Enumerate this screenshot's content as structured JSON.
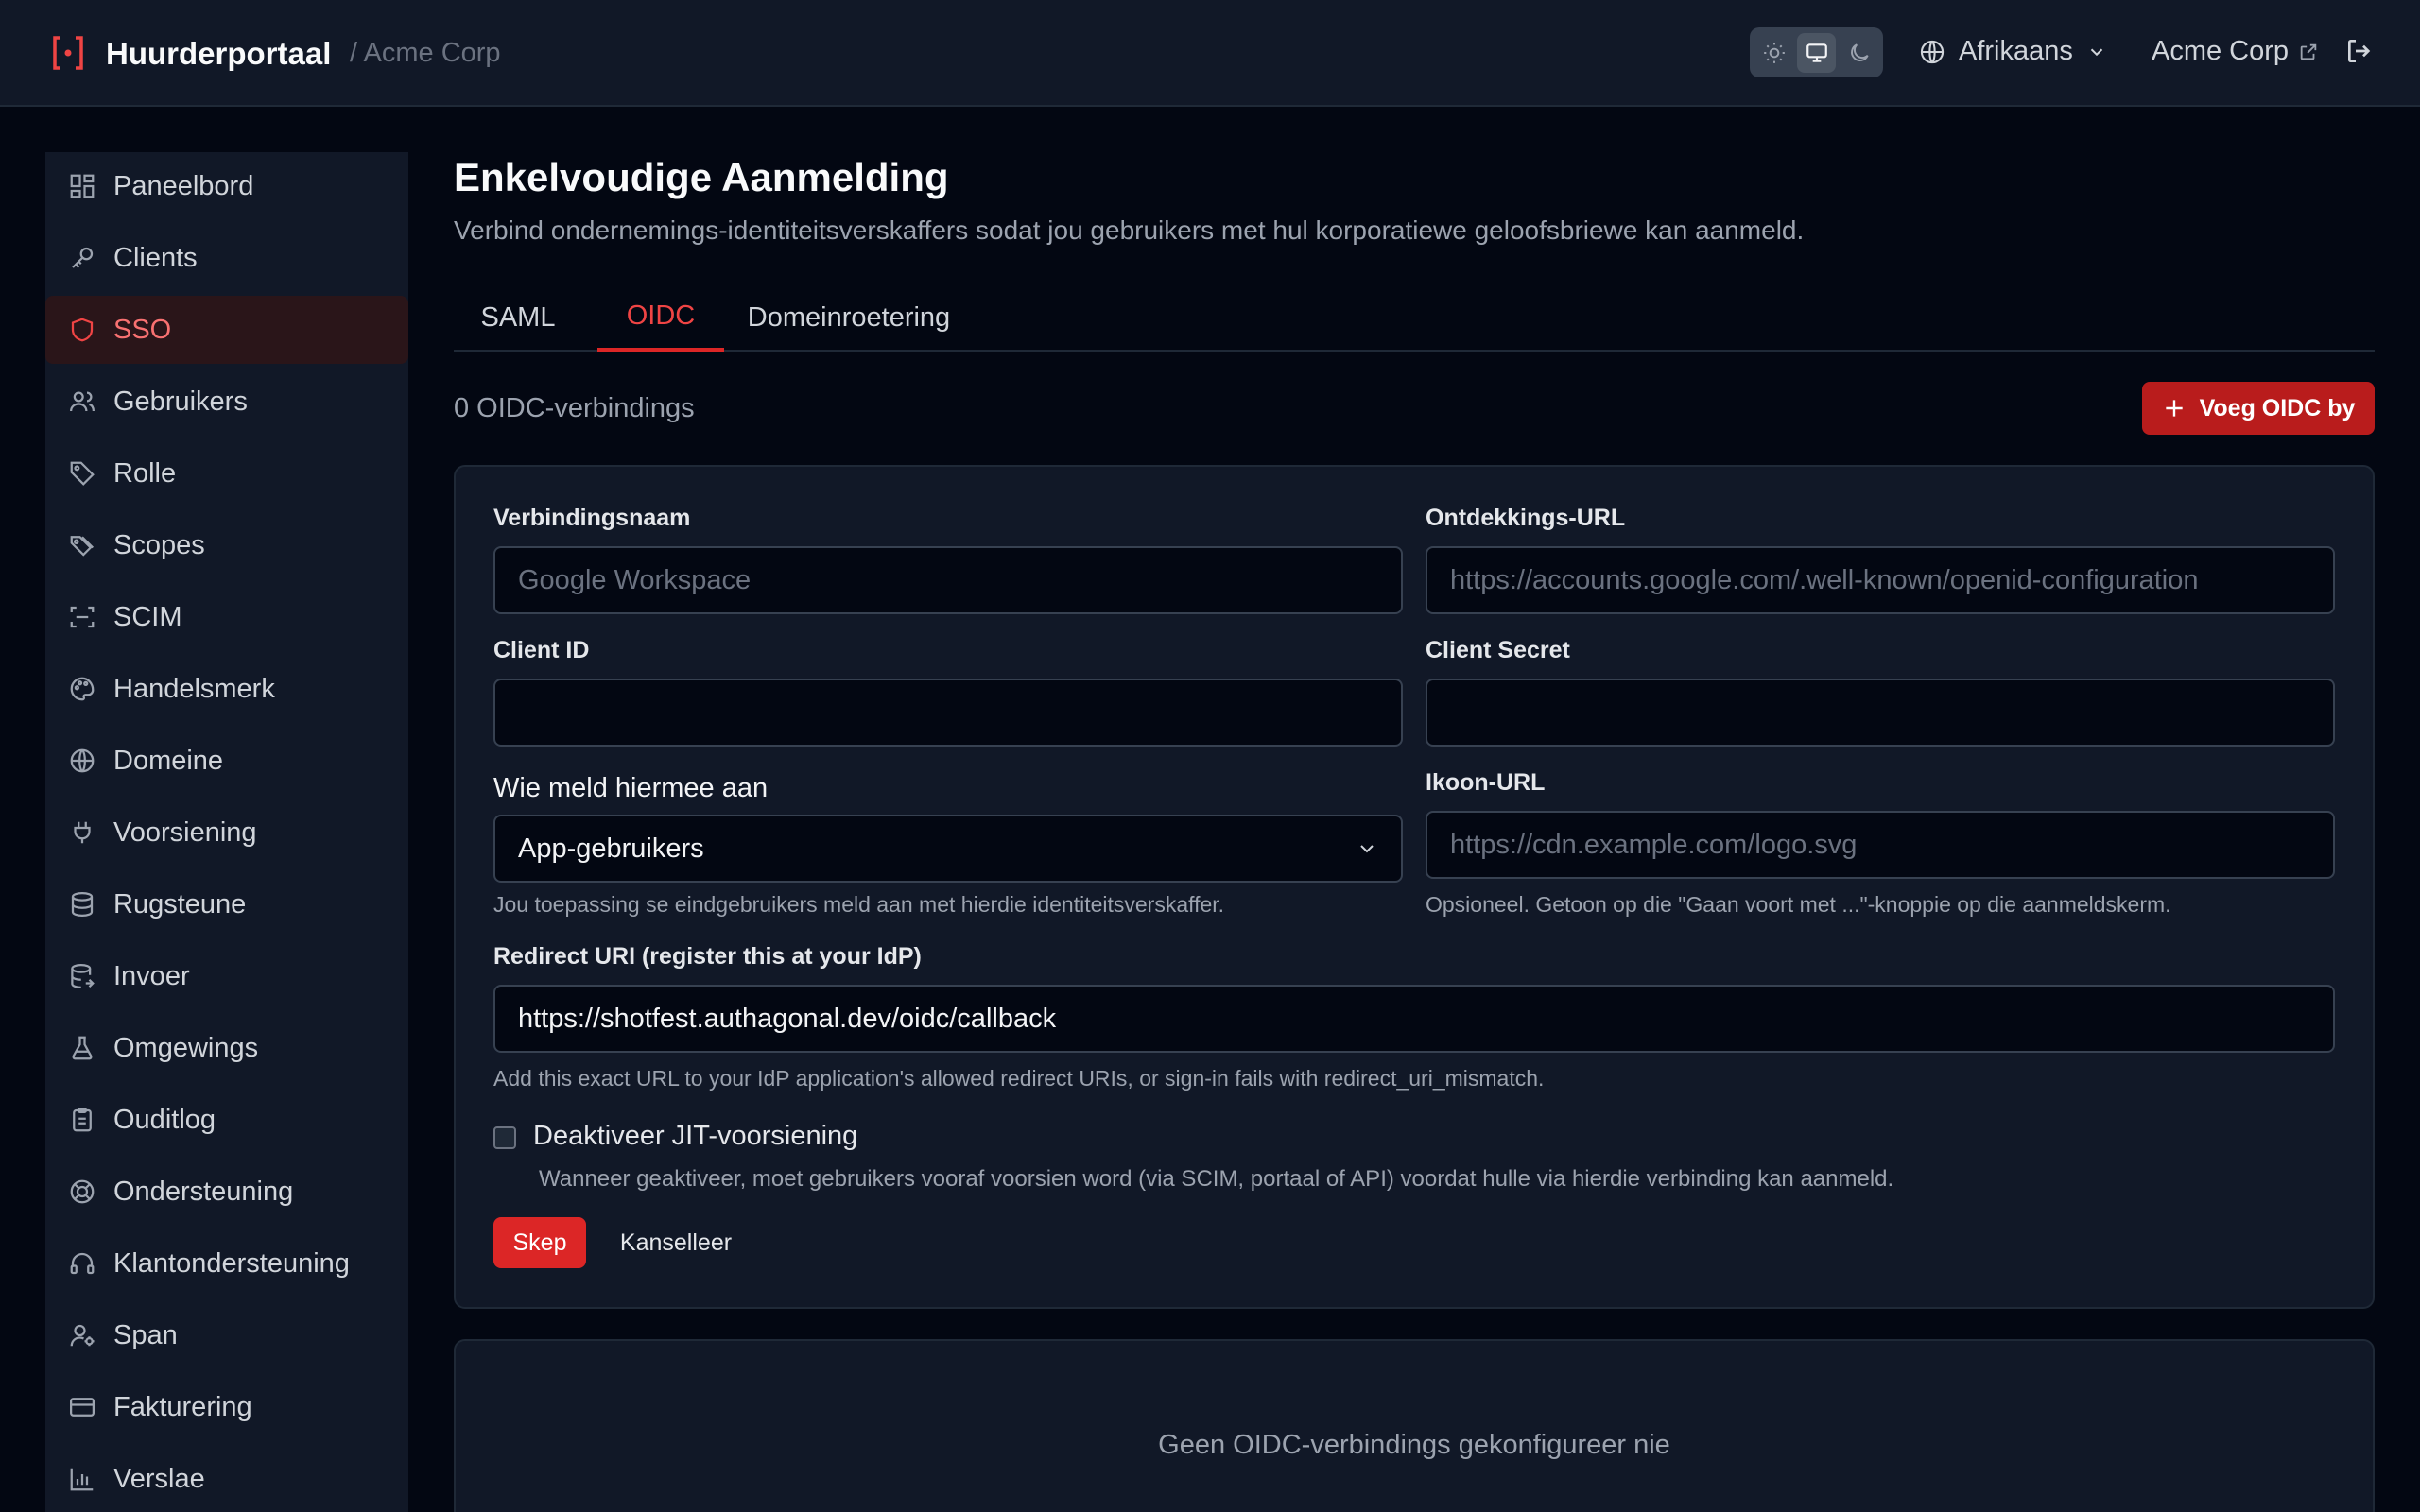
{
  "header": {
    "brand_title": "Huurderportaal",
    "tenant_path": "/ Acme Corp",
    "language": "Afrikaans",
    "tenant_link": "Acme Corp",
    "theme_modes": [
      "light-icon",
      "monitor-icon",
      "moon-icon"
    ],
    "active_theme": "monitor-icon"
  },
  "sidebar": {
    "items": [
      {
        "label": "Paneelbord",
        "icon": "dashboard-icon"
      },
      {
        "label": "Clients",
        "icon": "key-icon"
      },
      {
        "label": "SSO",
        "icon": "shield-icon",
        "active": true
      },
      {
        "label": "Gebruikers",
        "icon": "users-icon"
      },
      {
        "label": "Rolle",
        "icon": "tag-icon"
      },
      {
        "label": "Scopes",
        "icon": "tags-icon"
      },
      {
        "label": "SCIM",
        "icon": "scan-icon"
      },
      {
        "label": "Handelsmerk",
        "icon": "palette-icon"
      },
      {
        "label": "Domeine",
        "icon": "globe-icon"
      },
      {
        "label": "Voorsiening",
        "icon": "plug-icon"
      },
      {
        "label": "Rugsteune",
        "icon": "database-icon"
      },
      {
        "label": "Invoer",
        "icon": "database-import-icon"
      },
      {
        "label": "Omgewings",
        "icon": "flask-icon"
      },
      {
        "label": "Ouditlog",
        "icon": "clipboard-icon"
      },
      {
        "label": "Ondersteuning",
        "icon": "lifebuoy-icon"
      },
      {
        "label": "Klantondersteuning",
        "icon": "headphones-icon"
      },
      {
        "label": "Span",
        "icon": "user-cog-icon"
      },
      {
        "label": "Fakturering",
        "icon": "credit-card-icon"
      },
      {
        "label": "Verslae",
        "icon": "bar-chart-icon"
      }
    ]
  },
  "main": {
    "title": "Enkelvoudige Aanmelding",
    "subtitle": "Verbind ondernemings-identiteitsverskaffers sodat jou gebruikers met hul korporatiewe geloofsbriewe kan aanmeld.",
    "tabs": [
      {
        "label": "SAML"
      },
      {
        "label": "OIDC",
        "active": true
      },
      {
        "label": "Domeinroetering"
      }
    ],
    "connection_count": "0 OIDC-verbindings",
    "add_button": "Voeg OIDC by",
    "form": {
      "name_label": "Verbindingsnaam",
      "name_placeholder": "Google Workspace",
      "discovery_label": "Ontdekkings-URL",
      "discovery_placeholder": "https://accounts.google.com/.well-known/openid-configuration",
      "client_id_label": "Client ID",
      "client_id_value": "",
      "client_secret_label": "Client Secret",
      "client_secret_value": "",
      "audience_label": "Wie meld hiermee aan",
      "audience_value": "App-gebruikers",
      "audience_hint": "Jou toepassing se eindgebruikers meld aan met hierdie identiteitsverskaffer.",
      "icon_label": "Ikoon-URL",
      "icon_placeholder": "https://cdn.example.com/logo.svg",
      "icon_hint": "Opsioneel. Getoon op die \"Gaan voort met ...\"-knoppie op die aanmeldskerm.",
      "redirect_label": "Redirect URI (register this at your IdP)",
      "redirect_value": "https://shotfest.authagonal.dev/oidc/callback",
      "redirect_hint": "Add this exact URL to your IdP application's allowed redirect URIs, or sign-in fails with redirect_uri_mismatch.",
      "jit_label": "Deaktiveer JIT-voorsiening",
      "jit_checked": false,
      "jit_hint": "Wanneer geaktiveer, moet gebruikers vooraf voorsien word (via SCIM, portaal of API) voordat hulle via hierdie verbinding kan aanmeld.",
      "create_button": "Skep",
      "cancel_button": "Kanselleer"
    },
    "empty_state": "Geen OIDC-verbindings gekonfigureer nie"
  },
  "colors": {
    "accent": "#dc2626",
    "background": "#030712",
    "panel": "#111827"
  }
}
